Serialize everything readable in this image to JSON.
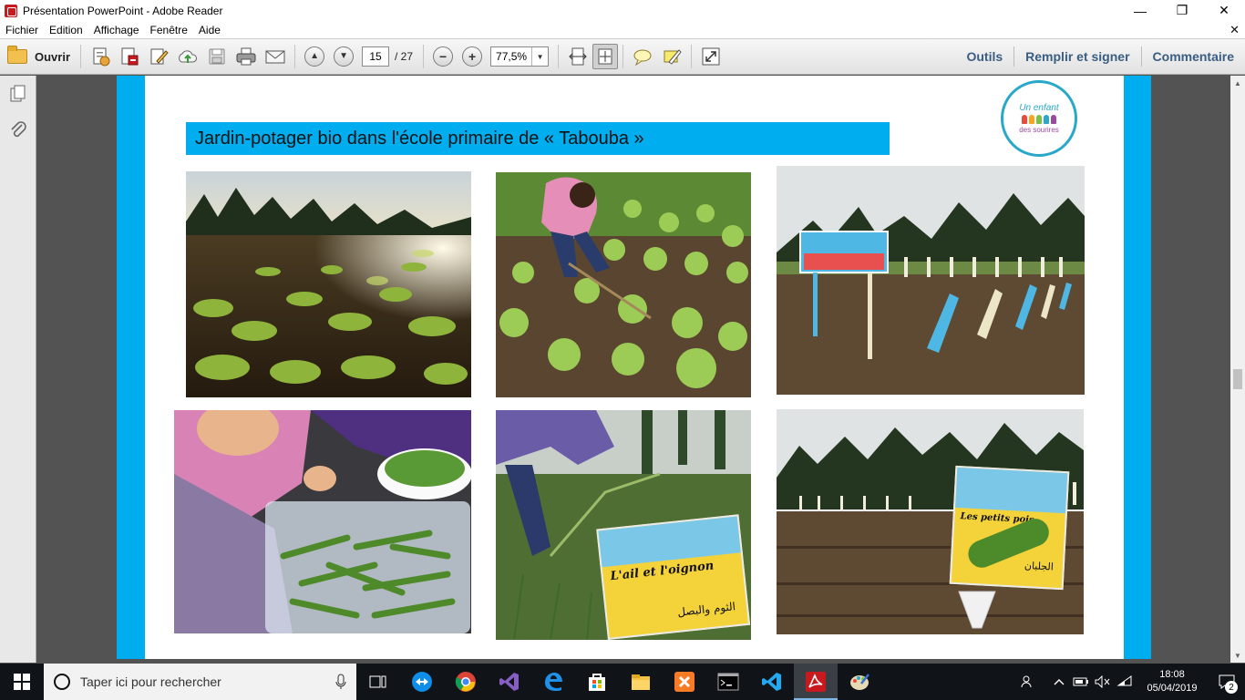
{
  "window": {
    "title": "Présentation PowerPoint - Adobe Reader",
    "minimize_glyph": "—",
    "restore_glyph": "❐",
    "close_glyph": "✕"
  },
  "menu": {
    "items": [
      "Fichier",
      "Edition",
      "Affichage",
      "Fenêtre",
      "Aide"
    ],
    "close_doc_glyph": "✕"
  },
  "toolbar": {
    "open_label": "Ouvrir",
    "page_current": "15",
    "page_total": "/ 27",
    "zoom_value": "77,5%",
    "tools_label": "Outils",
    "fill_sign_label": "Remplir et signer",
    "comment_label": "Commentaire",
    "zoom_out_glyph": "−",
    "zoom_in_glyph": "+",
    "prev_glyph": "▲",
    "next_glyph": "▼",
    "dropdown_glyph": "▼"
  },
  "slide": {
    "title": "Jardin-potager bio dans l'école primaire de « Tabouba »",
    "logo": {
      "line1": "Un enfant",
      "line2": "des sourires"
    },
    "photos": [
      {
        "name": "sunlit-vegetable-field"
      },
      {
        "name": "child-planting-lettuce"
      },
      {
        "name": "garden-signboard-and-fence"
      },
      {
        "name": "children-shelling-peas"
      },
      {
        "name": "child-pulling-onions",
        "sign_text_fr": "L'ail et l'oignon",
        "sign_text_ar": "الثوم والبصل"
      },
      {
        "name": "peas-sign-in-field",
        "sign_text_fr": "Les petits pois",
        "sign_text_ar": "الجلبان"
      }
    ]
  },
  "taskbar": {
    "search_placeholder": "Taper ici pour rechercher",
    "clock_time": "18:08",
    "clock_date": "05/04/2019",
    "notification_count": "2"
  },
  "colors": {
    "slide_accent": "#00adef",
    "toolbar_link": "#3a5d82",
    "taskbar_bg": "#101418"
  }
}
